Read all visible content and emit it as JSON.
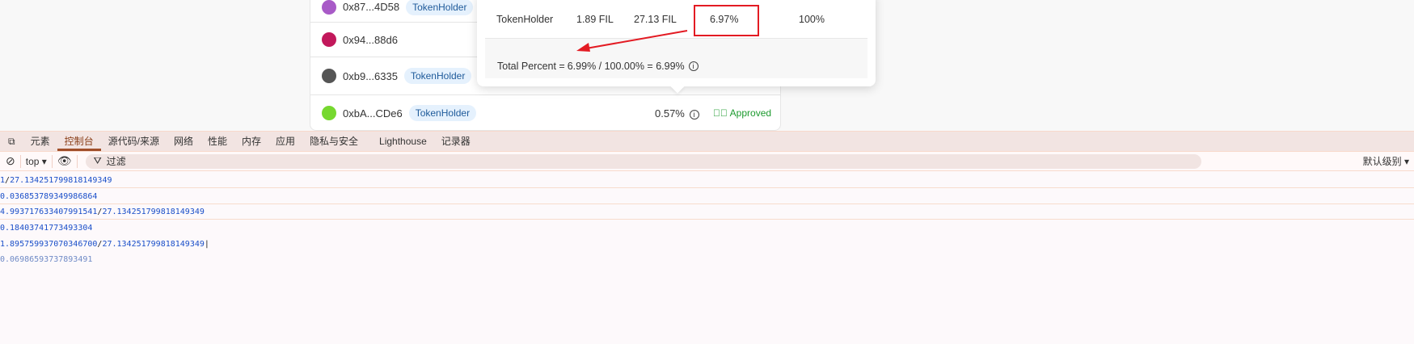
{
  "holders": [
    {
      "address": "0x87...4D58",
      "badge": "TokenHolder",
      "avatar_color": "#a85ac7"
    },
    {
      "address": "0x94...88d6",
      "badge": "",
      "avatar_color": "#c2185b"
    },
    {
      "address": "0xb9...6335",
      "badge": "TokenHolder",
      "avatar_color": "#555555"
    },
    {
      "address": "0xbA...CDe6",
      "badge": "TokenHolder",
      "avatar_color": "#76d82f",
      "percent": "0.57%",
      "status": "Approved"
    }
  ],
  "popover": {
    "role": "TokenHolder",
    "amount": "1.89 FIL",
    "total": "27.13 FIL",
    "percent": "6.97%",
    "share": "100%",
    "total_label": "Total Percent =",
    "total_formula": "6.99% / 100.00% = 6.99%"
  },
  "devtools": {
    "tabs": [
      "元素",
      "控制台",
      "源代码/来源",
      "网络",
      "性能",
      "内存",
      "应用",
      "隐私与安全",
      "Lighthouse",
      "记录器"
    ],
    "active_tab": "控制台",
    "context": "top",
    "filter_placeholder": "过滤",
    "level": "默认级别",
    "console": [
      {
        "a": "1",
        "b": "27.134251799818149349"
      },
      {
        "v": "0.036853789349986864"
      },
      {
        "a": "4.993717633407991541",
        "b": "27.134251799818149349"
      },
      {
        "v": "0.18403741773493304"
      },
      {
        "a": "1.895759937070346700",
        "b": "27.134251799818149349"
      },
      {
        "v": "0.06986593737893491"
      }
    ]
  },
  "colors": {
    "highlight": "#e31b23",
    "approved": "#1c9a2e"
  }
}
